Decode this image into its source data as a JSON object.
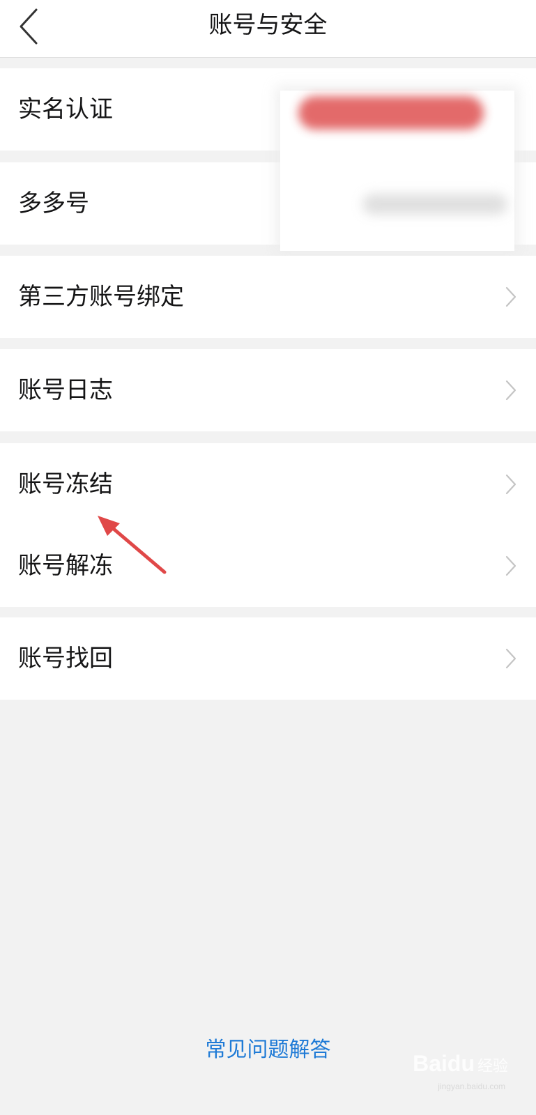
{
  "header": {
    "title": "账号与安全"
  },
  "rows": [
    {
      "label": "实名认证",
      "has_chevron": false
    },
    {
      "label": "多多号",
      "has_chevron": false
    },
    {
      "label": "第三方账号绑定",
      "has_chevron": true
    },
    {
      "label": "账号日志",
      "has_chevron": true
    },
    {
      "label": "账号冻结",
      "has_chevron": true
    },
    {
      "label": "账号解冻",
      "has_chevron": true
    },
    {
      "label": "账号找回",
      "has_chevron": true
    }
  ],
  "footer": {
    "faq_label": "常见问题解答"
  },
  "watermark": {
    "brand": "Baidu",
    "brand_cn": "经验",
    "url": "jingyan.baidu.com"
  },
  "colors": {
    "link": "#1e7ad6",
    "annotation_arrow": "#e04848",
    "background": "#f2f2f2"
  }
}
